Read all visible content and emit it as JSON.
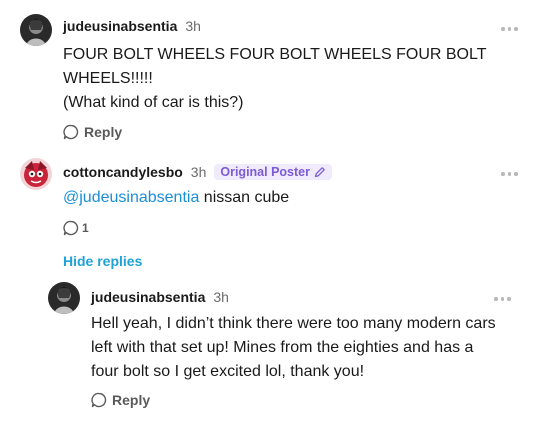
{
  "comments": [
    {
      "username": "judeusinabsentia",
      "time": "3h",
      "lines": [
        "FOUR BOLT WHEELS FOUR BOLT WHEELS FOUR BOLT",
        "WHEELS!!!!!",
        "(What kind of car is this?)"
      ],
      "reply_label": "Reply"
    },
    {
      "username": "cottoncandylesbo",
      "time": "3h",
      "badge": "Original Poster",
      "mention": "@judeusinabsentia",
      "text": " nissan cube",
      "like_count": "1",
      "hide_replies_label": "Hide replies"
    },
    {
      "username": "judeusinabsentia",
      "time": "3h",
      "lines": [
        "Hell yeah, I didn’t think there were too many modern cars",
        "left with that set up! Mines from the eighties and has a",
        "four bolt so I get excited lol, thank you!"
      ],
      "reply_label": "Reply"
    }
  ],
  "colors": {
    "mention": "#1a8fd8",
    "hide_replies": "#1fa3d6",
    "badge_text": "#7c5cd6",
    "badge_bg": "#efeafc"
  }
}
